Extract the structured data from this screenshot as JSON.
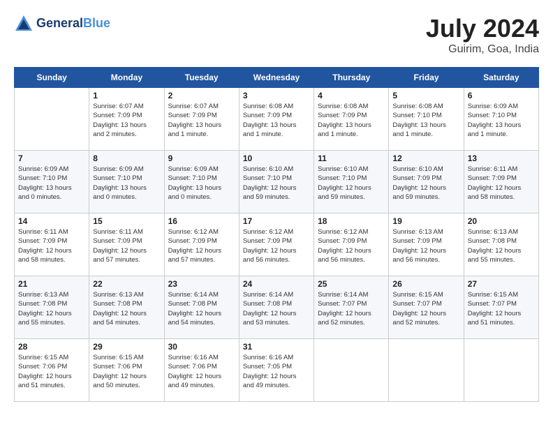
{
  "header": {
    "logo_line1": "General",
    "logo_line2": "Blue",
    "month": "July 2024",
    "location": "Guirim, Goa, India"
  },
  "weekdays": [
    "Sunday",
    "Monday",
    "Tuesday",
    "Wednesday",
    "Thursday",
    "Friday",
    "Saturday"
  ],
  "weeks": [
    [
      {
        "day": "",
        "info": ""
      },
      {
        "day": "1",
        "info": "Sunrise: 6:07 AM\nSunset: 7:09 PM\nDaylight: 13 hours\nand 2 minutes."
      },
      {
        "day": "2",
        "info": "Sunrise: 6:07 AM\nSunset: 7:09 PM\nDaylight: 13 hours\nand 1 minute."
      },
      {
        "day": "3",
        "info": "Sunrise: 6:08 AM\nSunset: 7:09 PM\nDaylight: 13 hours\nand 1 minute."
      },
      {
        "day": "4",
        "info": "Sunrise: 6:08 AM\nSunset: 7:09 PM\nDaylight: 13 hours\nand 1 minute."
      },
      {
        "day": "5",
        "info": "Sunrise: 6:08 AM\nSunset: 7:10 PM\nDaylight: 13 hours\nand 1 minute."
      },
      {
        "day": "6",
        "info": "Sunrise: 6:09 AM\nSunset: 7:10 PM\nDaylight: 13 hours\nand 1 minute."
      }
    ],
    [
      {
        "day": "7",
        "info": "Sunrise: 6:09 AM\nSunset: 7:10 PM\nDaylight: 13 hours\nand 0 minutes."
      },
      {
        "day": "8",
        "info": "Sunrise: 6:09 AM\nSunset: 7:10 PM\nDaylight: 13 hours\nand 0 minutes."
      },
      {
        "day": "9",
        "info": "Sunrise: 6:09 AM\nSunset: 7:10 PM\nDaylight: 13 hours\nand 0 minutes."
      },
      {
        "day": "10",
        "info": "Sunrise: 6:10 AM\nSunset: 7:10 PM\nDaylight: 12 hours\nand 59 minutes."
      },
      {
        "day": "11",
        "info": "Sunrise: 6:10 AM\nSunset: 7:10 PM\nDaylight: 12 hours\nand 59 minutes."
      },
      {
        "day": "12",
        "info": "Sunrise: 6:10 AM\nSunset: 7:09 PM\nDaylight: 12 hours\nand 59 minutes."
      },
      {
        "day": "13",
        "info": "Sunrise: 6:11 AM\nSunset: 7:09 PM\nDaylight: 12 hours\nand 58 minutes."
      }
    ],
    [
      {
        "day": "14",
        "info": "Sunrise: 6:11 AM\nSunset: 7:09 PM\nDaylight: 12 hours\nand 58 minutes."
      },
      {
        "day": "15",
        "info": "Sunrise: 6:11 AM\nSunset: 7:09 PM\nDaylight: 12 hours\nand 57 minutes."
      },
      {
        "day": "16",
        "info": "Sunrise: 6:12 AM\nSunset: 7:09 PM\nDaylight: 12 hours\nand 57 minutes."
      },
      {
        "day": "17",
        "info": "Sunrise: 6:12 AM\nSunset: 7:09 PM\nDaylight: 12 hours\nand 56 minutes."
      },
      {
        "day": "18",
        "info": "Sunrise: 6:12 AM\nSunset: 7:09 PM\nDaylight: 12 hours\nand 56 minutes."
      },
      {
        "day": "19",
        "info": "Sunrise: 6:13 AM\nSunset: 7:09 PM\nDaylight: 12 hours\nand 56 minutes."
      },
      {
        "day": "20",
        "info": "Sunrise: 6:13 AM\nSunset: 7:08 PM\nDaylight: 12 hours\nand 55 minutes."
      }
    ],
    [
      {
        "day": "21",
        "info": "Sunrise: 6:13 AM\nSunset: 7:08 PM\nDaylight: 12 hours\nand 55 minutes."
      },
      {
        "day": "22",
        "info": "Sunrise: 6:13 AM\nSunset: 7:08 PM\nDaylight: 12 hours\nand 54 minutes."
      },
      {
        "day": "23",
        "info": "Sunrise: 6:14 AM\nSunset: 7:08 PM\nDaylight: 12 hours\nand 54 minutes."
      },
      {
        "day": "24",
        "info": "Sunrise: 6:14 AM\nSunset: 7:08 PM\nDaylight: 12 hours\nand 53 minutes."
      },
      {
        "day": "25",
        "info": "Sunrise: 6:14 AM\nSunset: 7:07 PM\nDaylight: 12 hours\nand 52 minutes."
      },
      {
        "day": "26",
        "info": "Sunrise: 6:15 AM\nSunset: 7:07 PM\nDaylight: 12 hours\nand 52 minutes."
      },
      {
        "day": "27",
        "info": "Sunrise: 6:15 AM\nSunset: 7:07 PM\nDaylight: 12 hours\nand 51 minutes."
      }
    ],
    [
      {
        "day": "28",
        "info": "Sunrise: 6:15 AM\nSunset: 7:06 PM\nDaylight: 12 hours\nand 51 minutes."
      },
      {
        "day": "29",
        "info": "Sunrise: 6:15 AM\nSunset: 7:06 PM\nDaylight: 12 hours\nand 50 minutes."
      },
      {
        "day": "30",
        "info": "Sunrise: 6:16 AM\nSunset: 7:06 PM\nDaylight: 12 hours\nand 49 minutes."
      },
      {
        "day": "31",
        "info": "Sunrise: 6:16 AM\nSunset: 7:05 PM\nDaylight: 12 hours\nand 49 minutes."
      },
      {
        "day": "",
        "info": ""
      },
      {
        "day": "",
        "info": ""
      },
      {
        "day": "",
        "info": ""
      }
    ]
  ]
}
